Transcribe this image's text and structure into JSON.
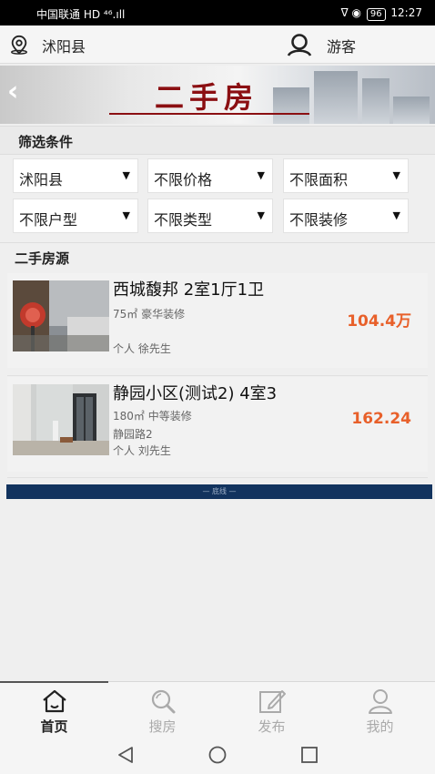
{
  "status_bar": {
    "carrier": "中国联通",
    "network": "HD ⁴⁶.ıll",
    "icons": "ᐁ ◉",
    "battery": "96",
    "time": "12:27"
  },
  "top_bar": {
    "location": "沭阳县",
    "user": "游客"
  },
  "banner": {
    "back_icon": "‹",
    "title": "二手房"
  },
  "filter_section": {
    "title": "筛选条件",
    "selects": [
      "沭阳县",
      "不限价格",
      "不限面积",
      "不限户型",
      "不限类型",
      "不限装修"
    ],
    "arrow": "▼"
  },
  "listing_section": {
    "title": "二手房源",
    "listings": [
      {
        "title": "西城馥邦 2室1厅1卫",
        "details": "75㎡ 豪华装修",
        "address": "",
        "owner": "个人 徐先生",
        "price": "104.4万"
      },
      {
        "title": "静园小区(测试2) 4室3",
        "details": "180㎡ 中等装修",
        "address": "静园路2",
        "owner": "个人 刘先生",
        "price": "162.24"
      }
    ]
  },
  "end_marker": "— 底线 —",
  "tabs": [
    {
      "label": "首页",
      "icon": "home-icon",
      "active": true
    },
    {
      "label": "搜房",
      "icon": "search-icon",
      "active": false
    },
    {
      "label": "发布",
      "icon": "edit-icon",
      "active": false
    },
    {
      "label": "我的",
      "icon": "user-icon",
      "active": false
    }
  ],
  "colors": {
    "price": "#e8602a",
    "banner_title": "#8b0f12",
    "end_bar": "#12335e"
  }
}
